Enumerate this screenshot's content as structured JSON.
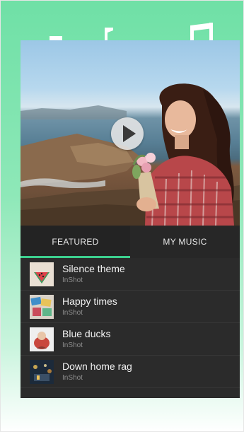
{
  "icons": {
    "note_left": "music-note-icon",
    "note_middle": "music-note-icon",
    "note_right": "double-music-note-icon",
    "play": "play-icon"
  },
  "colors": {
    "accent": "#3ccf8e",
    "panel": "#2b2b2b",
    "tab_active_indicator": "#3ccf8e"
  },
  "tabs": [
    {
      "label": "FEATURED",
      "active": true
    },
    {
      "label": "MY MUSIC",
      "active": false
    }
  ],
  "tracks": [
    {
      "title": "Silence theme",
      "artist": "InShot"
    },
    {
      "title": "Happy times",
      "artist": "InShot"
    },
    {
      "title": "Blue ducks",
      "artist": "InShot"
    },
    {
      "title": "Down home rag",
      "artist": "InShot"
    }
  ]
}
